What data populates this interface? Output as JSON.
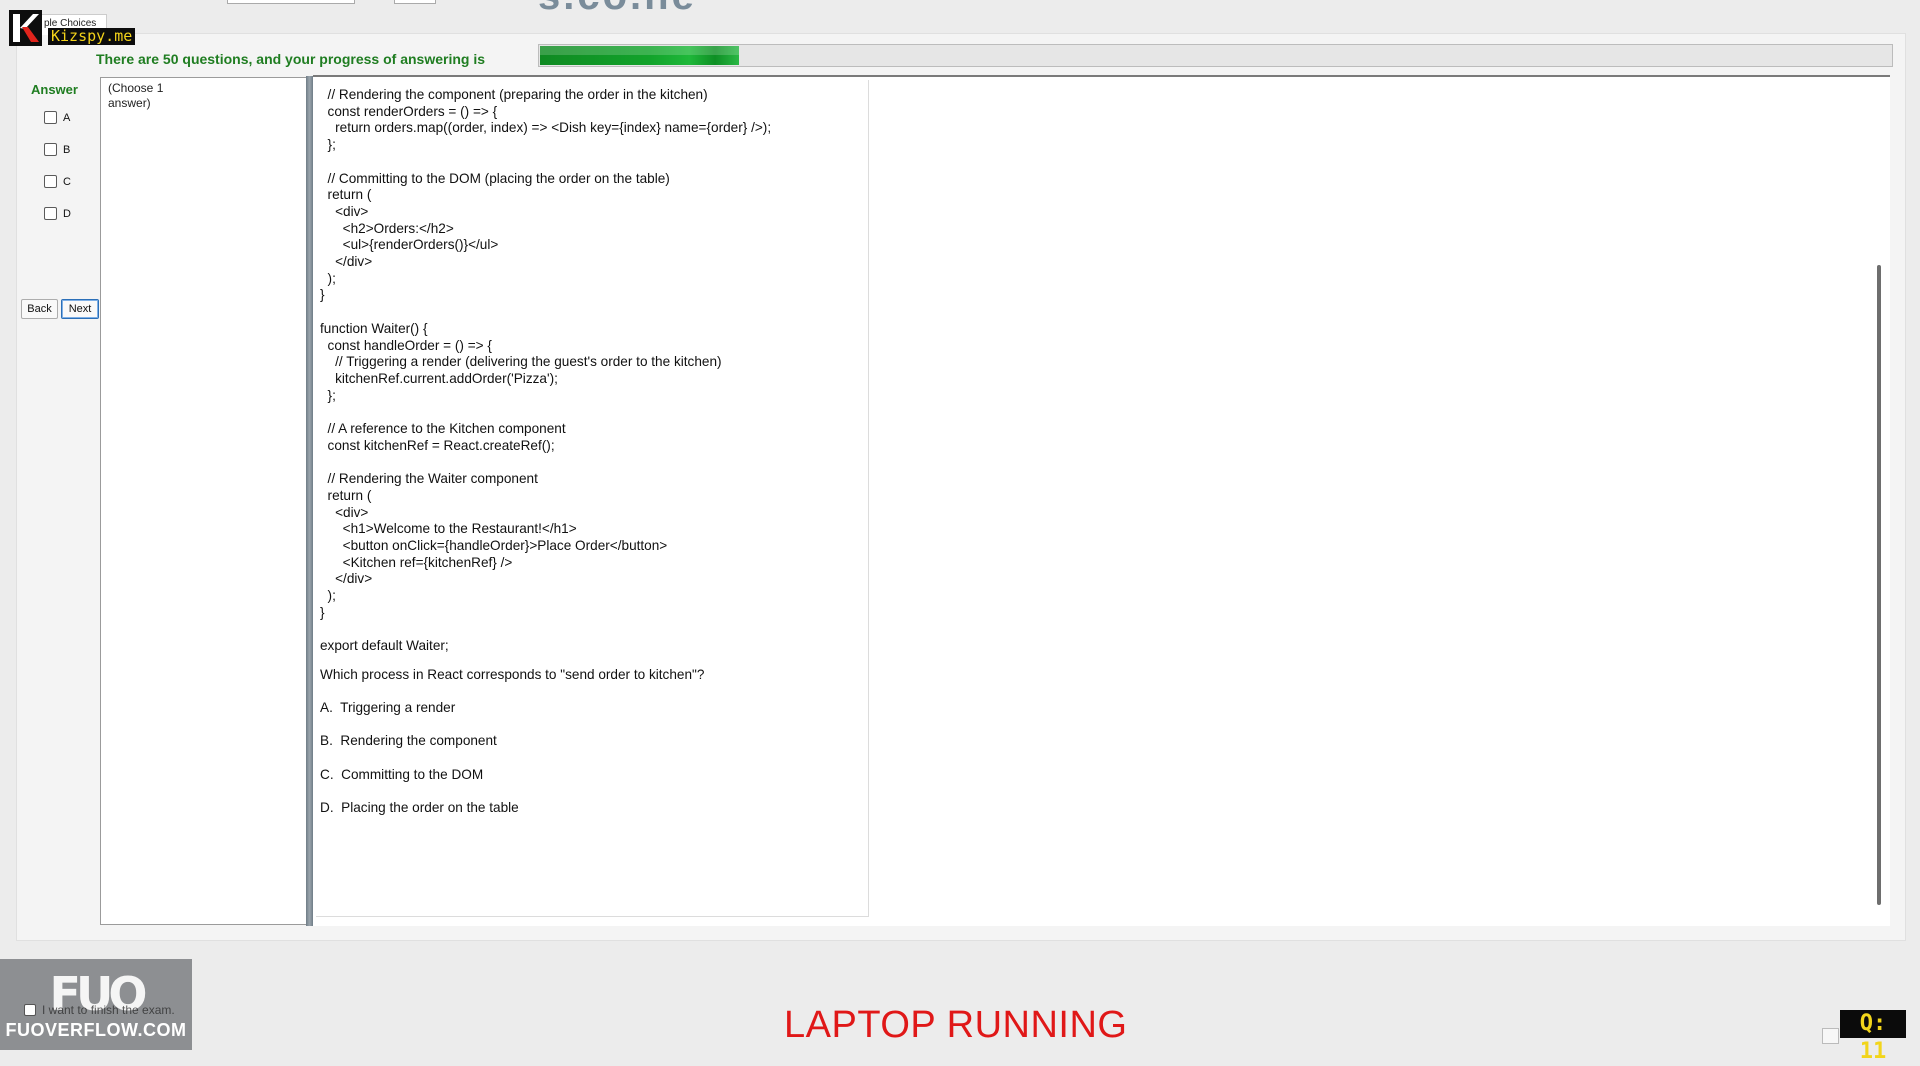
{
  "header": {
    "code": "s.co.ne"
  },
  "tab": {
    "label": "ple Choices"
  },
  "logo": {
    "letter": "K",
    "text": "Kizspy.me"
  },
  "progress": {
    "label": "There are 50 questions, and your progress of answering is",
    "fraction": 0.147
  },
  "answer": {
    "title": "Answer",
    "options": [
      "A",
      "B",
      "C",
      "D"
    ],
    "back_label": "Back",
    "next_label": "Next"
  },
  "instructions": {
    "text": "(Choose 1 answer)"
  },
  "question": {
    "code": "  // Rendering the component (preparing the order in the kitchen)\n  const renderOrders = () => {\n    return orders.map((order, index) => <Dish key={index} name={order} />);\n  };\n\n  // Committing to the DOM (placing the order on the table)\n  return (\n    <div>\n      <h2>Orders:</h2>\n      <ul>{renderOrders()}</ul>\n    </div>\n  );\n}\n\nfunction Waiter() {\n  const handleOrder = () => {\n    // Triggering a render (delivering the guest's order to the kitchen)\n    kitchenRef.current.addOrder('Pizza');\n  };\n\n  // A reference to the Kitchen component\n  const kitchenRef = React.createRef();\n\n  // Rendering the Waiter component\n  return (\n    <div>\n      <h1>Welcome to the Restaurant!</h1>\n      <button onClick={handleOrder}>Place Order</button>\n      <Kitchen ref={kitchenRef} />\n    </div>\n  );\n}\n\nexport default Waiter;",
    "prompt": "Which process in React corresponds to \"send order to kitchen\"?",
    "choices": [
      "A.  Triggering a render",
      "B.  Rendering the component",
      "C.  Committing to the DOM",
      "D.  Placing the order on the table"
    ]
  },
  "footer": {
    "watermark_top": "FUO",
    "watermark_bottom": "FUOVERFLOW.COM",
    "finish_label": "I want to finish the exam.",
    "status": "LAPTOP RUNNING",
    "q_badge": "Q: 11"
  }
}
